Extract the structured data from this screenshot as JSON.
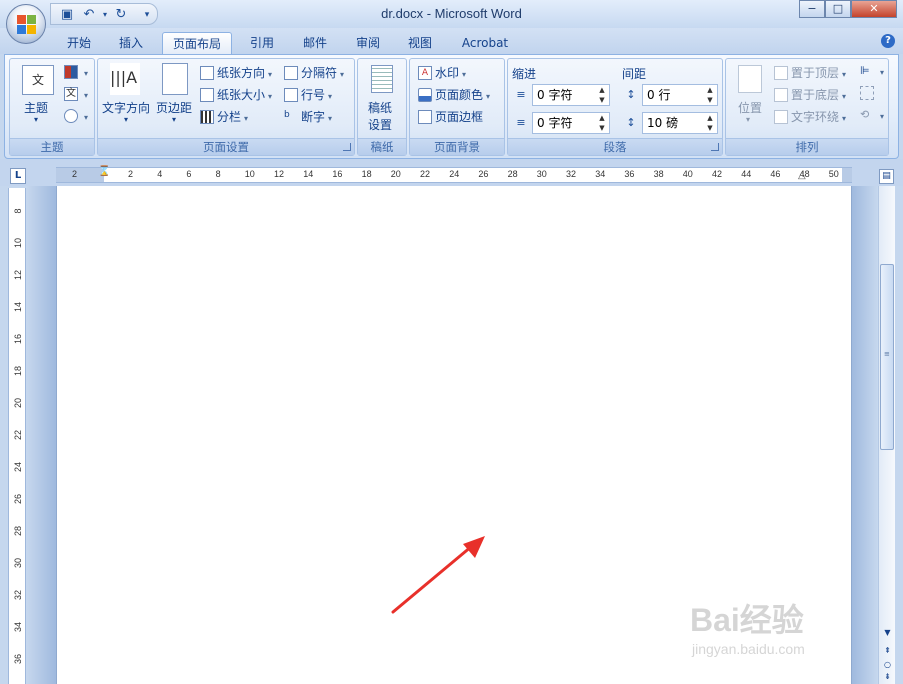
{
  "window": {
    "title": "dr.docx - Microsoft Word",
    "minimize": "−",
    "maximize": "□",
    "close": "✕"
  },
  "tabs": [
    {
      "label": "开始",
      "active": false
    },
    {
      "label": "插入",
      "active": false
    },
    {
      "label": "页面布局",
      "active": true
    },
    {
      "label": "引用",
      "active": false
    },
    {
      "label": "邮件",
      "active": false
    },
    {
      "label": "审阅",
      "active": false
    },
    {
      "label": "视图",
      "active": false
    },
    {
      "label": "Acrobat",
      "active": false
    }
  ],
  "ribbon": {
    "theme_group": {
      "label": "主题",
      "theme_button": "主题",
      "theme_icon_text": "文",
      "fonts_icon_text": "文"
    },
    "page_setup_group": {
      "label": "页面设置",
      "text_direction": "文字方向",
      "margins": "页边距",
      "orientation": "纸张方向",
      "size": "纸张大小",
      "columns": "分栏",
      "breaks": "分隔符",
      "line_numbers": "行号",
      "hyphenation": "断字"
    },
    "manuscript_group": {
      "label": "稿纸",
      "button_line1": "稿纸",
      "button_line2": "设置"
    },
    "page_background_group": {
      "label": "页面背景",
      "watermark": "水印",
      "page_color": "页面颜色",
      "page_borders": "页面边框"
    },
    "paragraph_group": {
      "label": "段落",
      "indent_title": "缩进",
      "spacing_title": "间距",
      "indent_left": "0 字符",
      "indent_right": "0 字符",
      "spacing_before": "0 行",
      "spacing_after": "10 磅"
    },
    "arrange_group": {
      "label": "排列",
      "position": "位置",
      "bring_front": "置于顶层",
      "send_back": "置于底层",
      "text_wrap": "文字环绕"
    }
  },
  "ruler": {
    "corner": "L",
    "h_ticks": [
      "2",
      "2",
      "4",
      "6",
      "8",
      "10",
      "12",
      "14",
      "16",
      "18",
      "20",
      "22",
      "24",
      "26",
      "28",
      "30",
      "32",
      "34",
      "36",
      "38",
      "40",
      "42",
      "44",
      "46",
      "48",
      "50"
    ],
    "v_ticks": [
      "8",
      "10",
      "12",
      "14",
      "16",
      "18",
      "20",
      "22",
      "24",
      "26",
      "28",
      "30",
      "32",
      "34",
      "36"
    ]
  },
  "watermark": {
    "brand": "Bai经验",
    "url": "jingyan.baidu.com"
  },
  "colors": {
    "arrow": "#e8302a",
    "ribbon_text": "#15428b"
  }
}
